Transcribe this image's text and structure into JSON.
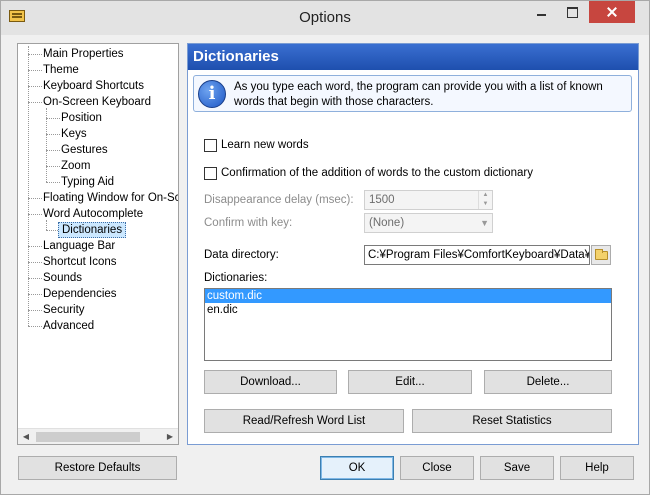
{
  "window": {
    "title": "Options"
  },
  "tree": {
    "items": [
      {
        "label": "Main Properties",
        "level": 0
      },
      {
        "label": "Theme",
        "level": 0
      },
      {
        "label": "Keyboard Shortcuts",
        "level": 0
      },
      {
        "label": "On-Screen Keyboard",
        "level": 0
      },
      {
        "label": "Position",
        "level": 1
      },
      {
        "label": "Keys",
        "level": 1
      },
      {
        "label": "Gestures",
        "level": 1
      },
      {
        "label": "Zoom",
        "level": 1
      },
      {
        "label": "Typing Aid",
        "level": 1
      },
      {
        "label": "Floating Window for On-Scre",
        "level": 0
      },
      {
        "label": "Word Autocomplete",
        "level": 0
      },
      {
        "label": "Dictionaries",
        "level": 1,
        "selected": true
      },
      {
        "label": "Language Bar",
        "level": 0
      },
      {
        "label": "Shortcut Icons",
        "level": 0
      },
      {
        "label": "Sounds",
        "level": 0
      },
      {
        "label": "Dependencies",
        "level": 0
      },
      {
        "label": "Security",
        "level": 0
      },
      {
        "label": "Advanced",
        "level": 0
      }
    ]
  },
  "panel": {
    "title": "Dictionaries",
    "info": "As you type each word, the program can provide you with a list of known words that begin with those characters.",
    "learn_new_words": {
      "label": "Learn new words",
      "checked": false
    },
    "confirm_addition": {
      "label": "Confirmation of the addition of words to the custom dictionary",
      "checked": false
    },
    "disappearance_delay": {
      "label": "Disappearance delay (msec):",
      "value": "1500"
    },
    "confirm_with_key": {
      "label": "Confirm with key:",
      "value": "(None)"
    },
    "data_directory": {
      "label": "Data directory:",
      "value": "C:¥Program Files¥ComfortKeyboard¥Data¥"
    },
    "dictionaries_label": "Dictionaries:",
    "dictionaries": [
      {
        "name": "custom.dic",
        "selected": true
      },
      {
        "name": "en.dic",
        "selected": false
      }
    ],
    "buttons": {
      "download": "Download...",
      "edit": "Edit...",
      "delete": "Delete...",
      "refresh": "Read/Refresh Word List",
      "reset": "Reset Statistics"
    }
  },
  "footer": {
    "restore": "Restore Defaults",
    "ok": "OK",
    "close": "Close",
    "save": "Save",
    "help": "Help"
  },
  "colors": {
    "header_blue": "#2a5bc2",
    "selection_blue": "#3399ff",
    "close_red": "#c7463f"
  }
}
